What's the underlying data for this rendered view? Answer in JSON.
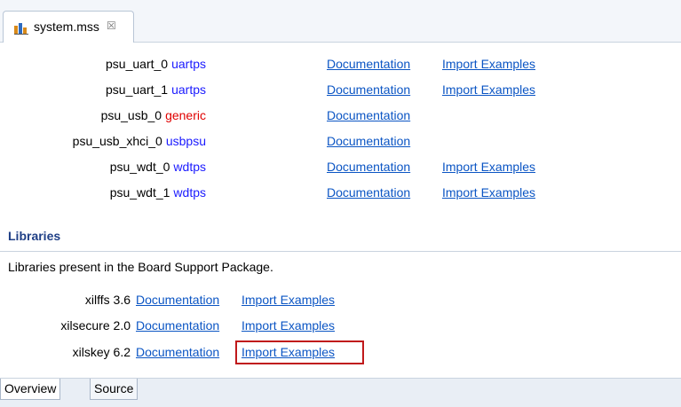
{
  "editor": {
    "tab_title": "system.mss",
    "close_glyph": "☒"
  },
  "drivers": [
    {
      "peripheral": "psu_uart_0",
      "driver": "uartps",
      "generic": false,
      "doc": "Documentation",
      "import": "Import Examples"
    },
    {
      "peripheral": "psu_uart_1",
      "driver": "uartps",
      "generic": false,
      "doc": "Documentation",
      "import": "Import Examples"
    },
    {
      "peripheral": "psu_usb_0",
      "driver": "generic",
      "generic": true,
      "doc": "Documentation",
      "import": ""
    },
    {
      "peripheral": "psu_usb_xhci_0",
      "driver": "usbpsu",
      "generic": false,
      "doc": "Documentation",
      "import": ""
    },
    {
      "peripheral": "psu_wdt_0",
      "driver": "wdtps",
      "generic": false,
      "doc": "Documentation",
      "import": "Import Examples"
    },
    {
      "peripheral": "psu_wdt_1",
      "driver": "wdtps",
      "generic": false,
      "doc": "Documentation",
      "import": "Import Examples"
    }
  ],
  "libraries": {
    "title": "Libraries",
    "description": "Libraries present in the Board Support Package.",
    "items": [
      {
        "name": "xilffs",
        "version": "3.6",
        "doc": "Documentation",
        "import": "Import Examples"
      },
      {
        "name": "xilsecure",
        "version": "2.0",
        "doc": "Documentation",
        "import": "Import Examples"
      },
      {
        "name": "xilskey",
        "version": "6.2",
        "doc": "Documentation",
        "import": "Import Examples"
      }
    ]
  },
  "bottom_tabs": [
    {
      "label": "Overview",
      "active": true
    },
    {
      "label": "Source",
      "active": false
    }
  ],
  "colors": {
    "link": "#0b55c4",
    "driver": "#1a1aff",
    "generic_driver": "#e00000",
    "section_title": "#1f3f86",
    "highlight": "#c0191b"
  }
}
